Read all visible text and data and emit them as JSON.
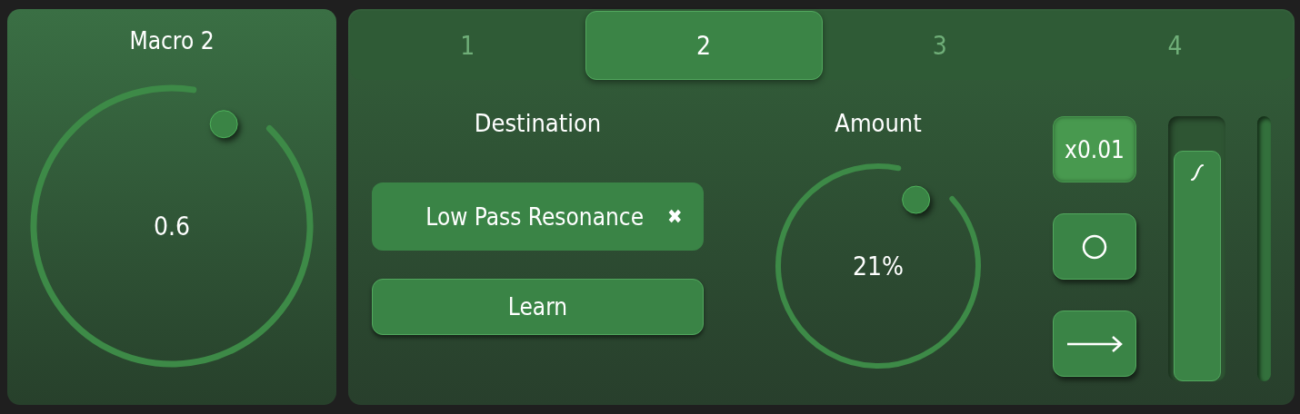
{
  "macro": {
    "title": "Macro 2",
    "value": "0.6"
  },
  "tabs": [
    {
      "label": "1",
      "selected": false
    },
    {
      "label": "2",
      "selected": true
    },
    {
      "label": "3",
      "selected": false
    },
    {
      "label": "4",
      "selected": false
    }
  ],
  "destination": {
    "heading": "Destination",
    "value": "Low Pass Resonance",
    "clear": "✖",
    "learn": "Learn"
  },
  "amount": {
    "heading": "Amount",
    "value": "21%"
  },
  "mode_buttons": [
    {
      "kind": "text",
      "label": "x0.01",
      "selected": true
    },
    {
      "kind": "circle",
      "selected": false
    },
    {
      "kind": "arrow",
      "selected": false
    }
  ],
  "slider": {
    "level": 0.87
  }
}
